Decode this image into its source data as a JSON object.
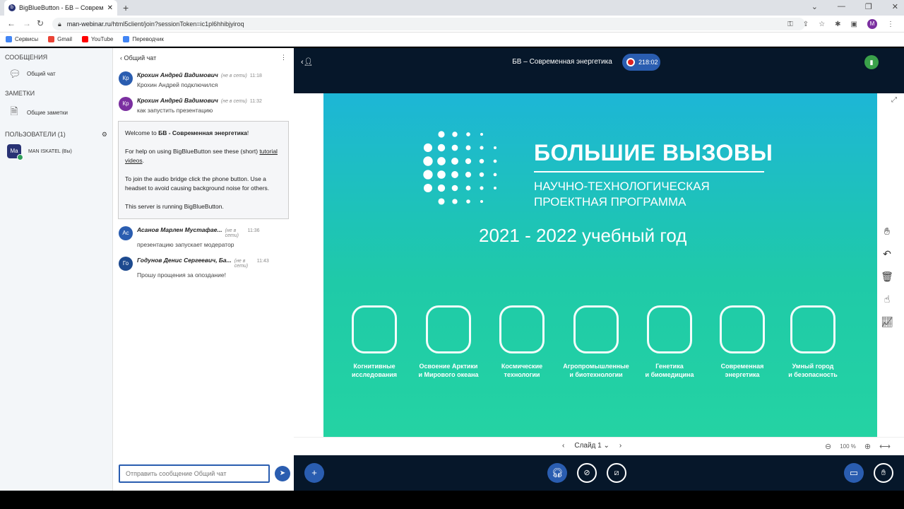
{
  "browser": {
    "tab_title": "BigBlueButton - БВ – Современная",
    "url_host": "man-webinar.ru",
    "url_path": "/html5client/join?sessionToken=ic1pl6hhibjyiroq",
    "bookmarks": [
      {
        "label": "Сервисы",
        "color": "#4285f4"
      },
      {
        "label": "Gmail",
        "color": "#ea4335"
      },
      {
        "label": "YouTube",
        "color": "#ff0000"
      },
      {
        "label": "Переводчик",
        "color": "#4285f4"
      }
    ],
    "profile_initial": "M"
  },
  "sidebar": {
    "messages_title": "СООБЩЕНИЯ",
    "public_chat_label": "Общий чат",
    "notes_title": "ЗАМЕТКИ",
    "shared_notes_label": "Общие заметки",
    "users_title": "ПОЛЬЗОВАТЕЛИ (1)",
    "user": {
      "initials": "Ma",
      "name": "MAN ISKATEL (Вы)"
    }
  },
  "chat": {
    "title": "Общий чат",
    "messages": [
      {
        "initials": "Кр",
        "color": "#2a5db0",
        "name": "Крохин Андрей Вадимович",
        "status": "(не в сети)",
        "time": "11:18",
        "text": "Крохин Андрей подключился"
      },
      {
        "initials": "Кр",
        "color": "#7b2fa0",
        "name": "Крохин Андрей Вадимович",
        "status": "(не в сети)",
        "time": "11:32",
        "text": "как запустить презентацию"
      }
    ],
    "welcome": {
      "line1_pre": "Welcome to ",
      "line1_bold": "БВ - Современная энергетика",
      "line1_post": "!",
      "line2_pre": "For help on using BigBlueButton see these (short) ",
      "line2_link": "tutorial videos",
      "line2_post": ".",
      "line3": "To join the audio bridge click the phone button. Use a headset to avoid causing background noise for others.",
      "line4": "This server is running BigBlueButton."
    },
    "messages2": [
      {
        "initials": "Ас",
        "color": "#2a5db0",
        "name": "Асанов Марлен Мустафае...",
        "status": "(не в сети)",
        "time": "11:36",
        "text": "презентацию запускает модератор"
      },
      {
        "initials": "Го",
        "color": "#1d4a8f",
        "name": "Годунов Денис Сергеевич, Ба...",
        "status": "(не в сети)",
        "time": "11:43",
        "text": "Прошу прощения за опоздание!"
      }
    ],
    "input_placeholder": "Отправить сообщение Общий чат"
  },
  "meeting": {
    "title": "БВ – Современная энергетика",
    "recording_time": "218:02"
  },
  "slide": {
    "title": "БОЛЬШИЕ ВЫЗОВЫ",
    "subtitle1": "НАУЧНО-ТЕХНОЛОГИЧЕСКАЯ",
    "subtitle2": "ПРОЕКТНАЯ ПРОГРАММА",
    "year": "2021 - 2022 учебный год",
    "categories": [
      {
        "line1": "Когнитивные",
        "line2": "исследования"
      },
      {
        "line1": "Освоение Арктики",
        "line2": "и Мирового океана"
      },
      {
        "line1": "Космические",
        "line2": "технологии"
      },
      {
        "line1": "Агропромышленные",
        "line2": "и биотехнологии"
      },
      {
        "line1": "Генетика",
        "line2": "и биомедицина"
      },
      {
        "line1": "Современная",
        "line2": "энергетика"
      },
      {
        "line1": "Умный город",
        "line2": "и безопасность"
      }
    ]
  },
  "slide_controls": {
    "slide_label": "Слайд 1",
    "zoom": "100 %"
  }
}
